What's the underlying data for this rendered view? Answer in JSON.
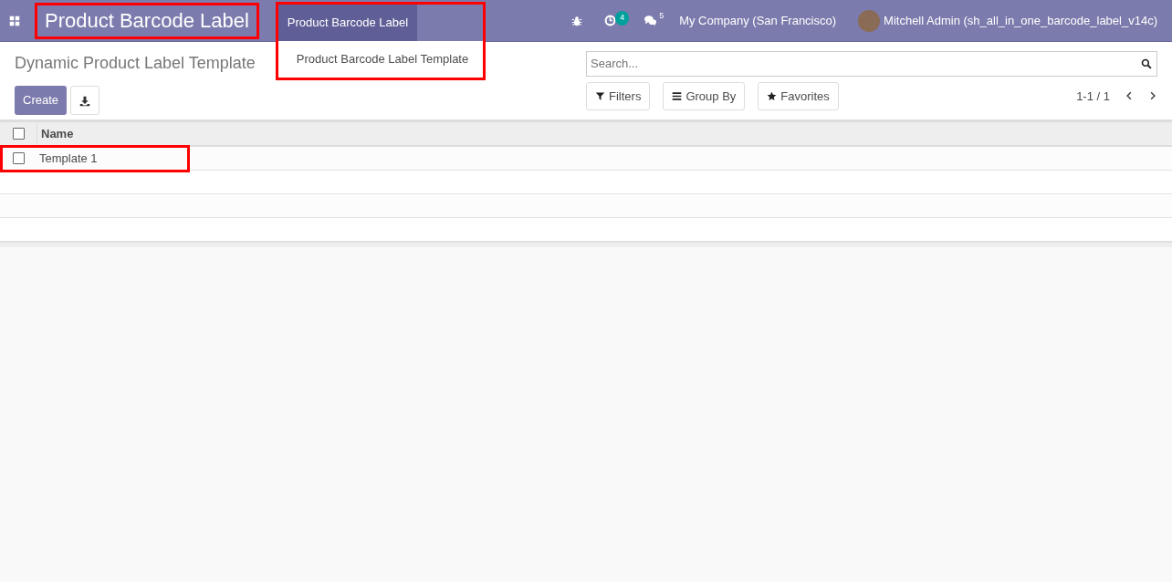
{
  "navbar": {
    "app_title": "Product Barcode Label",
    "app_title_highlighted": true,
    "menu": [
      {
        "label": "Product Barcode Label",
        "selected": true
      }
    ],
    "menu_highlighted": true,
    "dropdown": [
      {
        "label": "Product Barcode Label Template"
      }
    ],
    "activity_count": "4",
    "message_count": "5",
    "company": "My Company (San Francisco)",
    "user": "Mitchell Admin (sh_all_in_one_barcode_label_v14c)"
  },
  "control_panel": {
    "breadcrumb": "Dynamic Product Label Template",
    "create_button": "Create",
    "search": {
      "placeholder": "Search..."
    },
    "filter_buttons": [
      {
        "kind": "filter",
        "label": "Filters"
      },
      {
        "kind": "group",
        "label": "Group By"
      },
      {
        "kind": "favorite",
        "label": "Favorites"
      }
    ],
    "pager": "1-1 / 1"
  },
  "table": {
    "columns": [
      "Name"
    ],
    "rows": [
      {
        "cells": [
          "Template 1"
        ],
        "checked": false,
        "highlighted": true
      }
    ],
    "header_checked": false
  }
}
